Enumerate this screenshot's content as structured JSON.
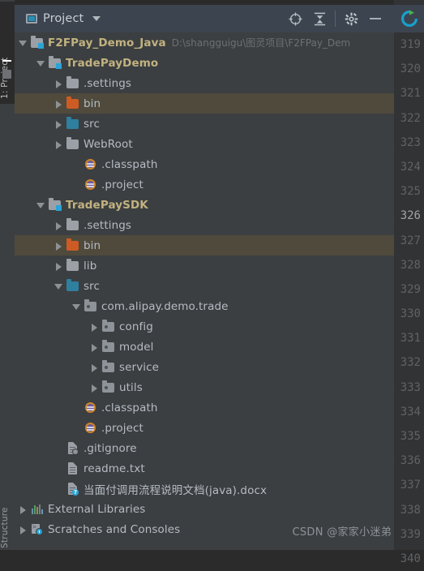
{
  "window": {
    "tool_strip_top_tab": "1: Project",
    "tool_strip_bottom_tab": "Structure"
  },
  "header": {
    "title": "Project",
    "icons": [
      {
        "name": "project-window-icon",
        "glyph": "window"
      },
      {
        "name": "chevron-down-icon",
        "glyph": "caret-down"
      },
      {
        "name": "locate-target-icon",
        "glyph": "crosshair"
      },
      {
        "name": "collapse-all-icon",
        "glyph": "collapse"
      },
      {
        "name": "settings-gear-icon",
        "glyph": "gear"
      },
      {
        "name": "minimize-icon",
        "glyph": "minus"
      },
      {
        "name": "refresh-icon",
        "glyph": "circular-arrow"
      }
    ],
    "accent_color": "#2aa4d8",
    "bar_color": "#3c4450"
  },
  "tree": {
    "rows": [
      {
        "label": "F2FPay_Demo_Java",
        "path": "D:\\shangguigu\\图灵项目\\F2FPay_Dem",
        "indent": 0,
        "arrow": "expanded",
        "icon": "module-folder",
        "bold": true,
        "highlight": false
      },
      {
        "label": "TradePayDemo",
        "path": "",
        "indent": 1,
        "arrow": "expanded",
        "icon": "module-folder",
        "bold": true,
        "highlight": false
      },
      {
        "label": ".settings",
        "path": "",
        "indent": 2,
        "arrow": "collapsed",
        "icon": "folder-gray",
        "bold": false,
        "highlight": false
      },
      {
        "label": "bin",
        "path": "",
        "indent": 2,
        "arrow": "collapsed",
        "icon": "folder-orange",
        "bold": false,
        "highlight": true
      },
      {
        "label": "src",
        "path": "",
        "indent": 2,
        "arrow": "collapsed",
        "icon": "folder-teal",
        "bold": false,
        "highlight": false
      },
      {
        "label": "WebRoot",
        "path": "",
        "indent": 2,
        "arrow": "collapsed",
        "icon": "folder-gray",
        "bold": false,
        "highlight": false
      },
      {
        "label": ".classpath",
        "path": "",
        "indent": 3,
        "arrow": "none",
        "icon": "eclipse-file",
        "bold": false,
        "highlight": false
      },
      {
        "label": ".project",
        "path": "",
        "indent": 3,
        "arrow": "none",
        "icon": "eclipse-file",
        "bold": false,
        "highlight": false
      },
      {
        "label": "TradePaySDK",
        "path": "",
        "indent": 1,
        "arrow": "expanded",
        "icon": "module-folder",
        "bold": true,
        "highlight": false
      },
      {
        "label": ".settings",
        "path": "",
        "indent": 2,
        "arrow": "collapsed",
        "icon": "folder-gray",
        "bold": false,
        "highlight": false
      },
      {
        "label": "bin",
        "path": "",
        "indent": 2,
        "arrow": "collapsed",
        "icon": "folder-orange",
        "bold": false,
        "highlight": true
      },
      {
        "label": "lib",
        "path": "",
        "indent": 2,
        "arrow": "collapsed",
        "icon": "folder-gray",
        "bold": false,
        "highlight": false
      },
      {
        "label": "src",
        "path": "",
        "indent": 2,
        "arrow": "expanded",
        "icon": "folder-teal",
        "bold": false,
        "highlight": false
      },
      {
        "label": "com.alipay.demo.trade",
        "path": "",
        "indent": 3,
        "arrow": "expanded",
        "icon": "package",
        "bold": false,
        "highlight": false
      },
      {
        "label": "config",
        "path": "",
        "indent": 4,
        "arrow": "collapsed",
        "icon": "package",
        "bold": false,
        "highlight": false
      },
      {
        "label": "model",
        "path": "",
        "indent": 4,
        "arrow": "collapsed",
        "icon": "package",
        "bold": false,
        "highlight": false
      },
      {
        "label": "service",
        "path": "",
        "indent": 4,
        "arrow": "collapsed",
        "icon": "package",
        "bold": false,
        "highlight": false
      },
      {
        "label": "utils",
        "path": "",
        "indent": 4,
        "arrow": "collapsed",
        "icon": "package",
        "bold": false,
        "highlight": false
      },
      {
        "label": ".classpath",
        "path": "",
        "indent": 3,
        "arrow": "none",
        "icon": "eclipse-file",
        "bold": false,
        "highlight": false
      },
      {
        "label": ".project",
        "path": "",
        "indent": 3,
        "arrow": "none",
        "icon": "eclipse-file",
        "bold": false,
        "highlight": false
      },
      {
        "label": ".gitignore",
        "path": "",
        "indent": 2,
        "arrow": "none",
        "icon": "file-ignored",
        "bold": false,
        "highlight": false
      },
      {
        "label": "readme.txt",
        "path": "",
        "indent": 2,
        "arrow": "none",
        "icon": "file-text",
        "bold": false,
        "highlight": false
      },
      {
        "label": "当面付调用流程说明文档(java).docx",
        "path": "",
        "indent": 2,
        "arrow": "none",
        "icon": "file-unknown",
        "bold": false,
        "highlight": false
      },
      {
        "label": "External Libraries",
        "path": "",
        "indent": 0,
        "arrow": "collapsed",
        "icon": "libraries",
        "bold": false,
        "highlight": false
      },
      {
        "label": "Scratches and Consoles",
        "path": "",
        "indent": 0,
        "arrow": "collapsed",
        "icon": "scratches",
        "bold": false,
        "highlight": false
      }
    ]
  },
  "gutter": {
    "current_line": 326,
    "line_numbers": [
      319,
      320,
      321,
      322,
      323,
      324,
      325,
      326,
      327,
      328,
      329,
      330,
      331,
      332,
      333,
      334,
      335,
      336,
      337,
      338,
      339,
      340
    ]
  },
  "watermark": {
    "text": "CSDN @家家小迷弟"
  },
  "colors": {
    "panel_bg": "#3c3f41",
    "header_bg": "#3c4450",
    "selection_bg": "#4f4a3c",
    "editor_bg": "#313335",
    "module_label": "#c2b280",
    "text": "#b5bcc4"
  }
}
